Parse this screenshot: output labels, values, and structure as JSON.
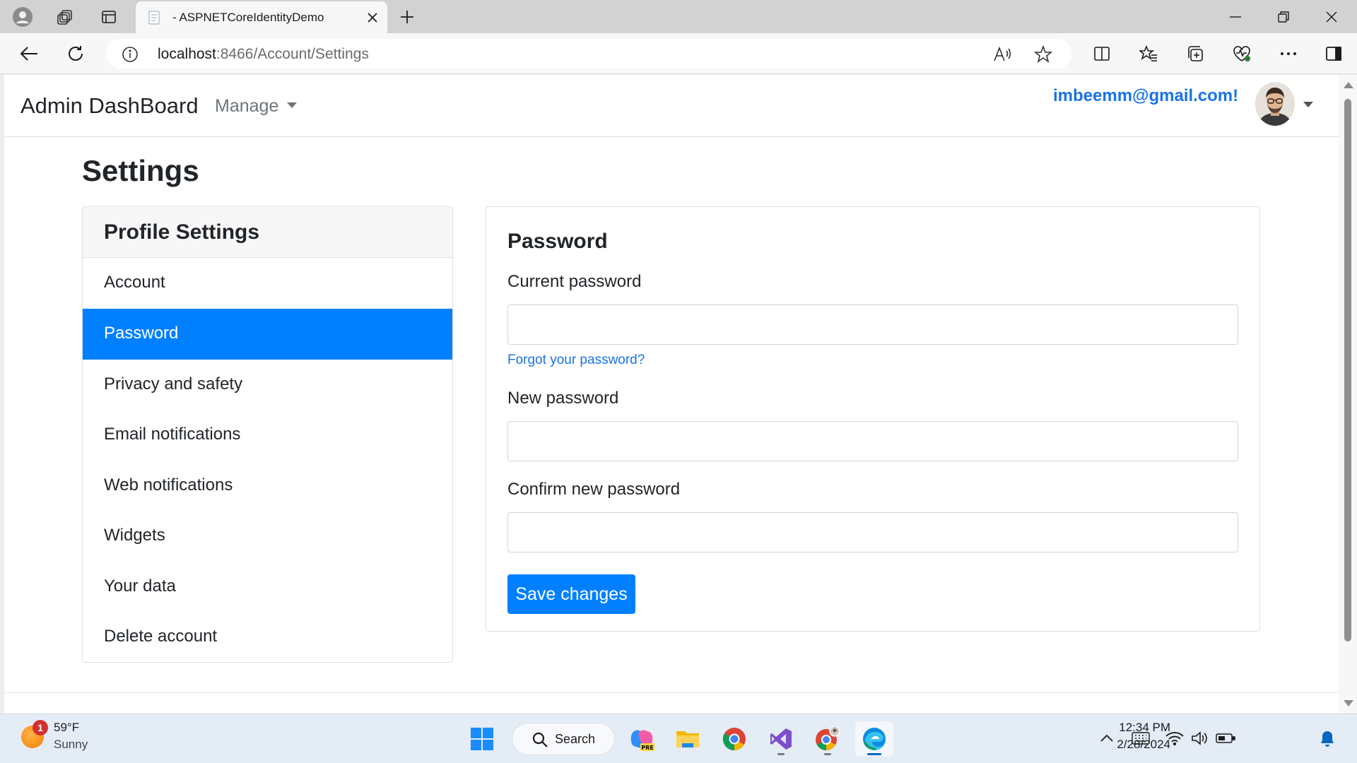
{
  "browser": {
    "tab_title": "- ASPNETCoreIdentityDemo",
    "url_host": "localhost",
    "url_rest": ":8466/Account/Settings"
  },
  "navbar": {
    "brand": "Admin DashBoard",
    "manage_label": "Manage",
    "user_email": "imbeemm@gmail.com!"
  },
  "page": {
    "heading": "Settings"
  },
  "sidebar": {
    "title": "Profile Settings",
    "items": [
      {
        "label": "Account",
        "active": false
      },
      {
        "label": "Password",
        "active": true
      },
      {
        "label": "Privacy and safety",
        "active": false
      },
      {
        "label": "Email notifications",
        "active": false
      },
      {
        "label": "Web notifications",
        "active": false
      },
      {
        "label": "Widgets",
        "active": false
      },
      {
        "label": "Your data",
        "active": false
      },
      {
        "label": "Delete account",
        "active": false
      }
    ]
  },
  "form": {
    "title": "Password",
    "current_label": "Current password",
    "current_value": "",
    "forgot_link": "Forgot your password?",
    "new_label": "New password",
    "new_value": "",
    "confirm_label": "Confirm new password",
    "confirm_value": "",
    "save_label": "Save changes"
  },
  "taskbar": {
    "weather_temp": "59°F",
    "weather_condition": "Sunny",
    "weather_badge": "1",
    "search_label": "Search",
    "time": "12:34 PM",
    "date": "2/28/2024",
    "pinned_apps": [
      "copilot-pre",
      "file-explorer",
      "chrome",
      "visual-studio",
      "chrome-profile",
      "edge"
    ]
  },
  "colors": {
    "accent": "#0080ff",
    "link": "#1a73e8",
    "brand_text": "#212529"
  }
}
